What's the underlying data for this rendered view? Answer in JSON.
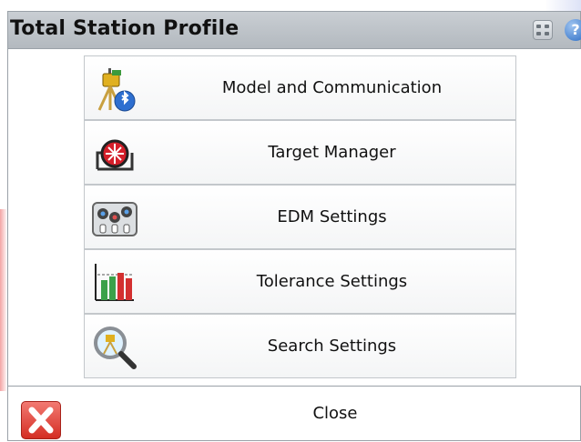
{
  "window": {
    "title": "Total Station Profile",
    "title_icons": [
      "calculator-icon",
      "help-icon"
    ],
    "help_glyph": "?"
  },
  "menu": {
    "items": [
      {
        "label": "Model and Communication",
        "icon": "total-station-bluetooth-icon"
      },
      {
        "label": "Target Manager",
        "icon": "prism-target-icon"
      },
      {
        "label": "EDM Settings",
        "icon": "edm-dials-icon"
      },
      {
        "label": "Tolerance Settings",
        "icon": "tolerance-bar-chart-icon"
      },
      {
        "label": "Search Settings",
        "icon": "search-magnifier-icon"
      }
    ]
  },
  "footer": {
    "close_label": "Close",
    "close_icon": "close-x-icon"
  },
  "colors": {
    "titlebar": "#b3b9bf",
    "close_red": "#d42d23",
    "help_blue": "#2b6cc4"
  }
}
